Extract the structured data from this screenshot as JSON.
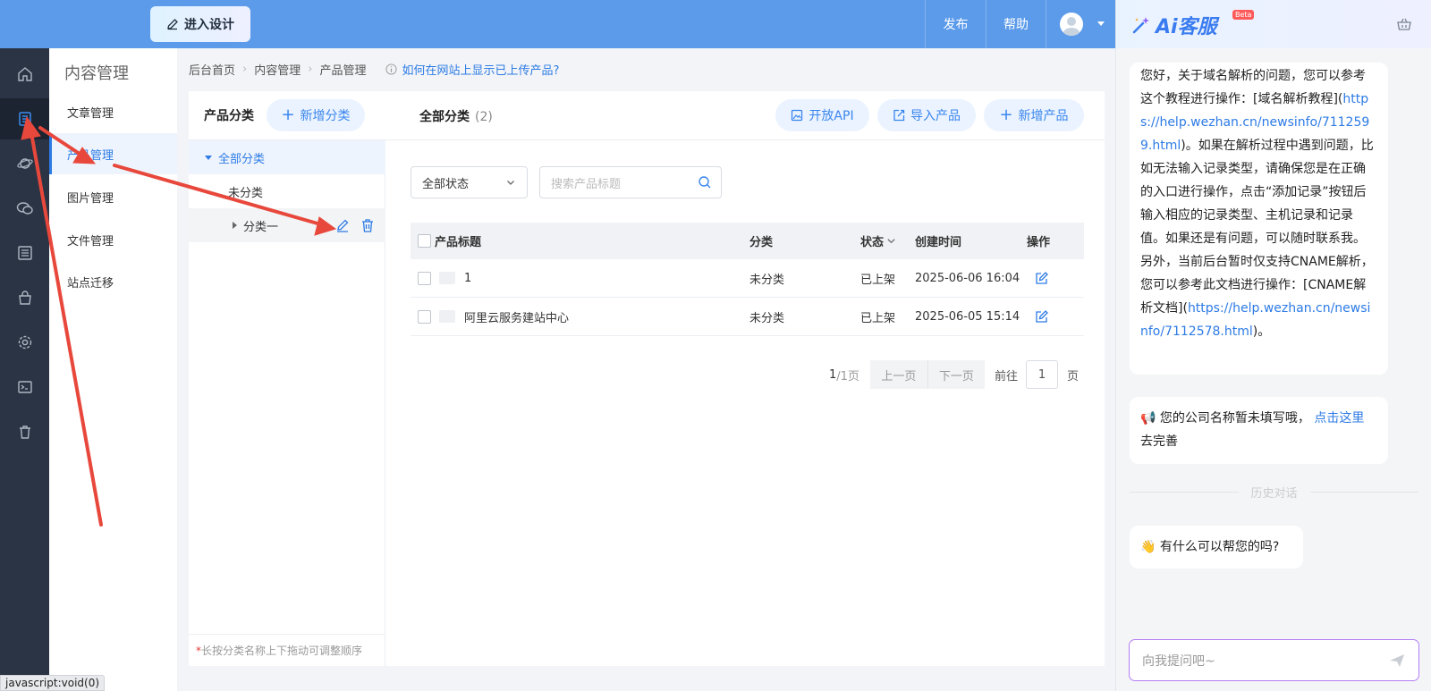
{
  "topbar": {
    "design_label": "进入设计",
    "publish_label": "发布",
    "help_label": "帮助"
  },
  "icon_sidebar": [
    "home-icon",
    "content-icon",
    "planet-icon",
    "chat-icon",
    "list-icon",
    "shop-icon",
    "gear-icon",
    "terminal-icon",
    "trash-icon"
  ],
  "nav": {
    "title": "内容管理",
    "items": [
      "文章管理",
      "产品管理",
      "图片管理",
      "文件管理",
      "站点迁移"
    ],
    "active_index": 1
  },
  "breadcrumb": {
    "items": [
      "后台首页",
      "内容管理",
      "产品管理"
    ],
    "help_text": "如何在网站上显示已上传产品?"
  },
  "categories": {
    "title": "产品分类",
    "add_label": "新增分类",
    "tree": [
      {
        "label": "全部分类",
        "selected": true
      },
      {
        "label": "未分类"
      },
      {
        "label": "分类一"
      }
    ],
    "footer_star": "*",
    "footer_text": "长按分类名称上下拖动可调整顺序"
  },
  "products": {
    "title": "全部分类",
    "count": "(2)",
    "buttons": {
      "api": "开放API",
      "import": "导入产品",
      "add": "新增产品"
    },
    "status_filter": "全部状态",
    "search_placeholder": "搜索产品标题",
    "columns": {
      "title": "产品标题",
      "category": "分类",
      "status": "状态",
      "created": "创建时间",
      "action": "操作"
    },
    "rows": [
      {
        "title": "1",
        "category": "未分类",
        "status": "已上架",
        "created": "2025-06-06 16:04"
      },
      {
        "title": "阿里云服务建站中心",
        "category": "未分类",
        "status": "已上架",
        "created": "2025-06-05 15:14"
      }
    ],
    "pager": {
      "current": "1",
      "total": "/1页",
      "prev": "上一页",
      "next": "下一页",
      "goto": "前往",
      "page_value": "1",
      "page_unit": "页"
    }
  },
  "chat": {
    "brand": "Ai客服",
    "beta": "Beta",
    "msg1_p1": "您好，关于域名解析的问题，您可以参考这个教程进行操作：[域名解析教程](",
    "msg1_link1": "https://help.wezhan.cn/newsinfo/7112599.html",
    "msg1_p2": ")。如果在解析过程中遇到问题，比如无法输入记录类型，请确保您是在正确的入口进行操作，点击“添加记录”按钮后输入相应的记录类型、主机记录和记录值。如果还是有问题，可以随时联系我。另外，当前后台暂时仅支持CNAME解析，您可以参考此文档进行操作：[CNAME解析文档](",
    "msg1_link2": "https://help.wezhan.cn/newsinfo/7112578.html",
    "msg1_p3": ")。",
    "msg2_emoji": "📢",
    "msg2_text": "您的公司名称暂未填写哦，",
    "msg2_link": "点击这里",
    "msg2_tail": "去完善",
    "history_label": "历史对话",
    "msg3_emoji": "👋",
    "msg3_text": "有什么可以帮您的吗?",
    "input_placeholder": "向我提问吧~"
  },
  "status_bar": "javascript:void(0)",
  "colors": {
    "topbar": "#5b9bea",
    "sidebar": "#2b3445",
    "accent": "#2d7be5",
    "annotation": "#e8483c"
  }
}
